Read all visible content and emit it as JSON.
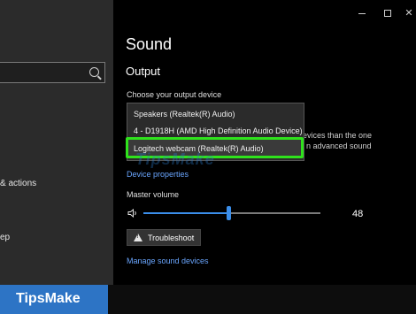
{
  "sidebar": {
    "items": [
      "& actions",
      "ep"
    ]
  },
  "window": {
    "close_glyph": "✕"
  },
  "page": {
    "title": "Sound",
    "section": "Output",
    "output_label": "Choose your output device",
    "devices": [
      "Speakers (Realtek(R) Audio)",
      "4 - D1918H (AMD High Definition Audio Device)",
      "Logitech webcam (Realtek(R) Audio)"
    ],
    "behind_text": [
      "evices than the one",
      "n advanced sound"
    ],
    "device_properties_link": "Device properties",
    "master_volume_label": "Master volume",
    "volume": 48,
    "volume_text": "48",
    "troubleshoot_label": "Troubleshoot",
    "manage_link": "Manage sound devices"
  },
  "watermark": "TipsMake",
  "brand": {
    "name": "TipsMake",
    "color": "#2d74c5"
  },
  "colors": {
    "accent": "#3b8eea",
    "highlight_box": "#2fe21c"
  }
}
